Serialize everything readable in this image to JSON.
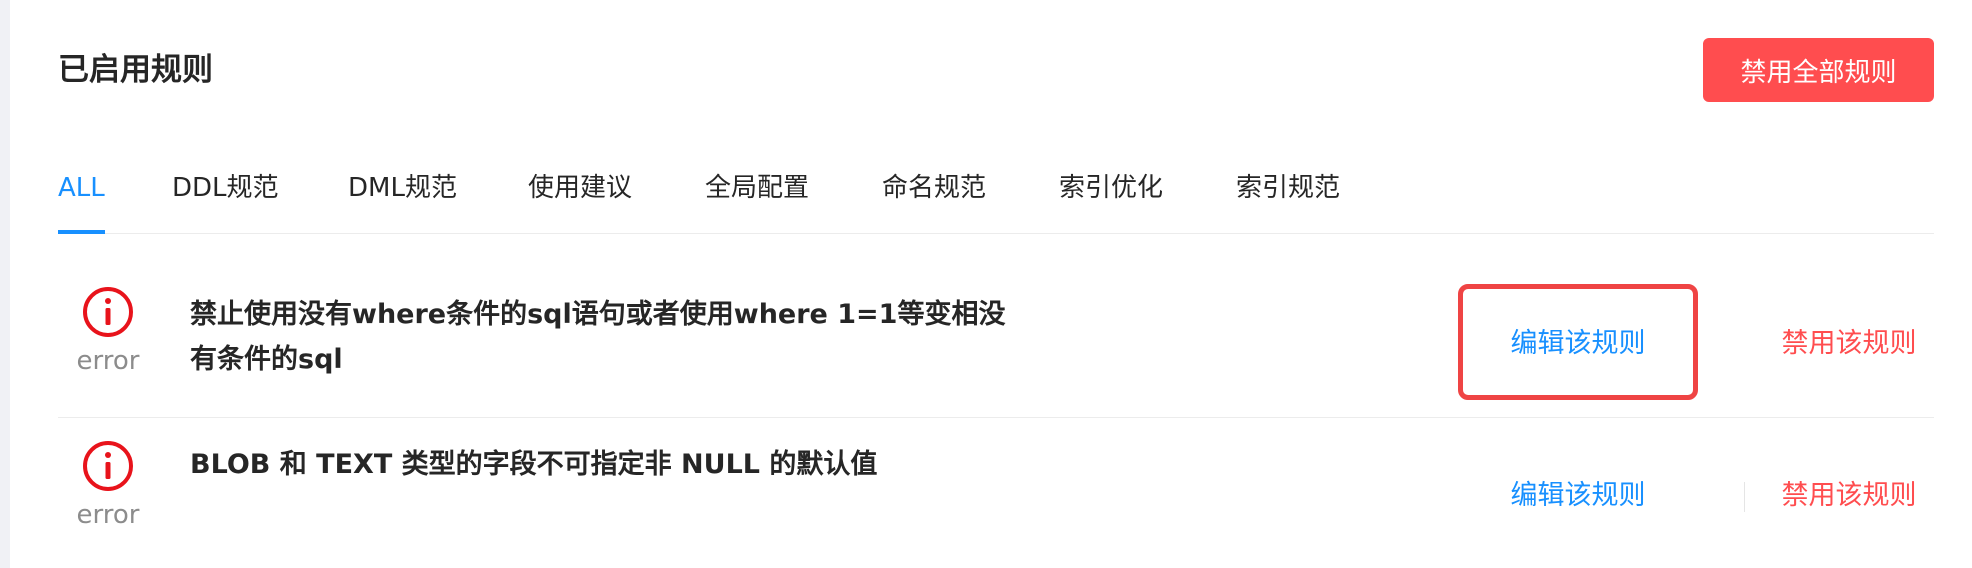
{
  "header": {
    "title": "已启用规则",
    "disable_all_label": "禁用全部规则"
  },
  "tabs": [
    {
      "label": "ALL",
      "active": true
    },
    {
      "label": "DDL规范",
      "active": false
    },
    {
      "label": "DML规范",
      "active": false
    },
    {
      "label": "使用建议",
      "active": false
    },
    {
      "label": "全局配置",
      "active": false
    },
    {
      "label": "命名规范",
      "active": false
    },
    {
      "label": "索引优化",
      "active": false
    },
    {
      "label": "索引规范",
      "active": false
    }
  ],
  "rules": [
    {
      "level_icon": "error-circle-icon",
      "level": "error",
      "description_line1": "禁止使用没有where条件的sql语句或者使用where 1=1等变相没",
      "description_line2": "有条件的sql",
      "edit_label": "编辑该规则",
      "disable_label": "禁用该规则"
    },
    {
      "level_icon": "error-circle-icon",
      "level": "error",
      "description_line1": "BLOB 和 TEXT 类型的字段不可指定非 NULL 的默认值",
      "edit_label": "编辑该规则",
      "disable_label": "禁用该规则"
    }
  ],
  "colors": {
    "accent": "#1890ff",
    "danger": "#ff4d4f",
    "error_icon": "#e8131b",
    "highlight": "#ef4444"
  }
}
